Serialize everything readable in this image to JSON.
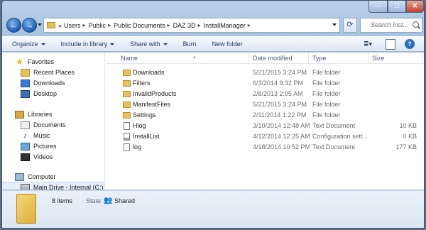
{
  "window": {
    "minimize": "—",
    "maximize": "□",
    "close": "✕"
  },
  "nav": {
    "back": "←",
    "forward": "→",
    "breadcrumbs_prefix": "«",
    "breadcrumbs": [
      "Users",
      "Public",
      "Public Documents",
      "DAZ 3D",
      "InstallManager"
    ],
    "separator": "▸",
    "refresh": "⟳",
    "search_placeholder": "Search Inst..."
  },
  "toolbar": {
    "organize": "Organize",
    "include_in_library": "Include in library",
    "share_with": "Share with",
    "burn": "Burn",
    "new_folder": "New folder",
    "views": "≣▾",
    "help": "?"
  },
  "sidebar": {
    "favorites": {
      "label": "Favorites",
      "items": [
        "Recent Places",
        "Downloads",
        "Desktop"
      ]
    },
    "libraries": {
      "label": "Libraries",
      "items": [
        "Documents",
        "Music",
        "Pictures",
        "Videos"
      ]
    },
    "computer": {
      "label": "Computer",
      "items": [
        "Main Drive - Internal (C:)"
      ]
    }
  },
  "columns": {
    "name": "Name",
    "date": "Date modified",
    "type": "Type",
    "size": "Size",
    "sort_indicator": "▲"
  },
  "files": [
    {
      "name": "Downloads",
      "date": "5/21/2015 3:24 PM",
      "type": "File folder",
      "size": "",
      "icon": "folder-icon"
    },
    {
      "name": "Filters",
      "date": "6/3/2014 9:32 PM",
      "type": "File folder",
      "size": "",
      "icon": "folder-icon"
    },
    {
      "name": "InvalidProducts",
      "date": "2/8/2013 2:05 AM",
      "type": "File folder",
      "size": "",
      "icon": "folder-icon"
    },
    {
      "name": "ManifestFiles",
      "date": "5/21/2015 3:24 PM",
      "type": "File folder",
      "size": "",
      "icon": "folder-icon"
    },
    {
      "name": "Settings",
      "date": "2/11/2014 1:22 PM",
      "type": "File folder",
      "size": "",
      "icon": "folder-icon"
    },
    {
      "name": "Hlog",
      "date": "3/10/2014 12:48 AM",
      "type": "Text Document",
      "size": "10 KB",
      "icon": "text-document-icon"
    },
    {
      "name": "InstallList",
      "date": "4/12/2014 12:25 AM",
      "type": "Configuration sett...",
      "size": "0 KB",
      "icon": "config-file-icon"
    },
    {
      "name": "log",
      "date": "4/18/2014 10:52 PM",
      "type": "Text Document",
      "size": "177 KB",
      "icon": "text-document-icon"
    }
  ],
  "details": {
    "count": "8 items",
    "state_label": "State:",
    "state": "Shared",
    "share_icon": "👥"
  }
}
